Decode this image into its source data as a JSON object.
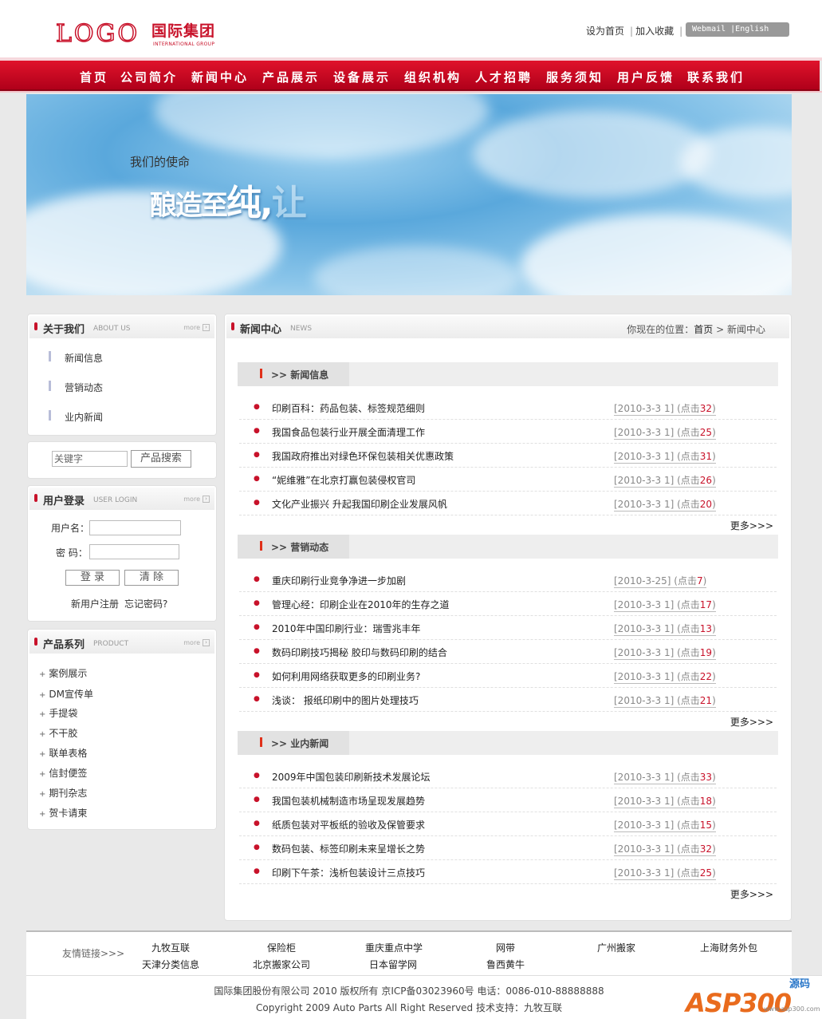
{
  "header": {
    "logo_en": "LOGO",
    "logo_cn": "国际集团",
    "logo_sub": "INTERNATIONAL GROUP",
    "links": [
      "设为首页",
      "加入收藏"
    ],
    "lang_box": "Webmail  |English"
  },
  "nav": [
    "首页",
    "公司简介",
    "新闻中心",
    "产品展示",
    "设备展示",
    "组织机构",
    "人才招聘",
    "服务须知",
    "用户反馈",
    "联系我们"
  ],
  "banner": {
    "mission": "我们的使命",
    "slogan_a": "酿造至",
    "slogan_b": "纯,",
    "slogan_c": "让"
  },
  "about": {
    "title": "关于我们",
    "title_en": "ABOUT US",
    "more": "more",
    "items": [
      "新闻信息",
      "营销动态",
      "业内新闻"
    ]
  },
  "search": {
    "placeholder": "关键字",
    "button": "产品搜索"
  },
  "login": {
    "title": "用户登录",
    "title_en": "USER LOGIN",
    "more": "more",
    "user_label": "用户名：",
    "pass_label": "密  码：",
    "login_btn": "登 录",
    "clear_btn": "清 除",
    "register": "新用户注册",
    "forgot": "忘记密码?"
  },
  "products": {
    "title": "产品系列",
    "title_en": "PRODUCT",
    "more": "more",
    "items": [
      "案例展示",
      "DM宣传单",
      "手提袋",
      "不干胶",
      "联单表格",
      "信封便签",
      "期刊杂志",
      "贺卡请柬"
    ]
  },
  "news_center": {
    "title": "新闻中心",
    "title_en": "NEWS",
    "breadcrumb_prefix": "你现在的位置：",
    "breadcrumb_home": "首页",
    "breadcrumb_current": "> 新闻中心",
    "more_label": "更多>>>",
    "sections": [
      {
        "heading": ">> 新闻信息",
        "items": [
          {
            "title": "印刷百科：药品包装、标签规范细则",
            "date": "[2010-3-3 1]",
            "clicks": "32"
          },
          {
            "title": "我国食品包装行业开展全面清理工作",
            "date": "[2010-3-3 1]",
            "clicks": "25"
          },
          {
            "title": "我国政府推出对绿色环保包装相关优惠政策",
            "date": "[2010-3-3 1]",
            "clicks": "31"
          },
          {
            "title": "“妮维雅”在北京打赢包装侵权官司",
            "date": "[2010-3-3 1]",
            "clicks": "26"
          },
          {
            "title": "文化产业振兴 升起我国印刷企业发展风帆",
            "date": "[2010-3-3 1]",
            "clicks": "20"
          }
        ]
      },
      {
        "heading": ">> 营销动态",
        "items": [
          {
            "title": "重庆印刷行业竞争净进一步加剧",
            "date": "[2010-3-25]",
            "clicks": "7"
          },
          {
            "title": "管理心经：印刷企业在2010年的生存之道",
            "date": "[2010-3-3 1]",
            "clicks": "17"
          },
          {
            "title": "2010年中国印刷行业：瑞雪兆丰年",
            "date": "[2010-3-3 1]",
            "clicks": "13"
          },
          {
            "title": "数码印刷技巧揭秘 胶印与数码印刷的结合",
            "date": "[2010-3-3 1]",
            "clicks": "19"
          },
          {
            "title": "如何利用网络获取更多的印刷业务?",
            "date": "[2010-3-3 1]",
            "clicks": "22"
          },
          {
            "title": "浅谈： 报纸印刷中的图片处理技巧",
            "date": "[2010-3-3 1]",
            "clicks": "21"
          }
        ]
      },
      {
        "heading": ">> 业内新闻",
        "items": [
          {
            "title": "2009年中国包装印刷新技术发展论坛",
            "date": "[2010-3-3 1]",
            "clicks": "33"
          },
          {
            "title": "我国包装机械制造市场呈现发展趋势",
            "date": "[2010-3-3 1]",
            "clicks": "18"
          },
          {
            "title": "纸质包装对平板纸的验收及保管要求",
            "date": "[2010-3-3 1]",
            "clicks": "15"
          },
          {
            "title": "数码包装、标签印刷未来呈增长之势",
            "date": "[2010-3-3 1]",
            "clicks": "32"
          },
          {
            "title": "印刷下午茶：浅析包装设计三点技巧",
            "date": "[2010-3-3 1]",
            "clicks": "25"
          }
        ]
      }
    ],
    "click_prefix": "(点击",
    "click_suffix": ")"
  },
  "footer": {
    "links_label": "友情链接>>>",
    "links_row1": [
      "九牧互联",
      "保险柜",
      "重庆重点中学",
      "网带",
      "广州搬家",
      "上海财务外包"
    ],
    "links_row2": [
      "天津分类信息",
      "北京搬家公司",
      "日本留学网",
      "鲁西黄牛"
    ],
    "copyright1": "国际集团股份有限公司 2010 版权所有 京ICP备03023960号 电话：0086-010-88888888",
    "copyright2": "Copyright 2009 Auto Parts All Right Reserved 技术支持：九牧互联"
  },
  "watermark": {
    "brand": "ASP300",
    "cn": "源码",
    "url": "www.asp300.com"
  }
}
